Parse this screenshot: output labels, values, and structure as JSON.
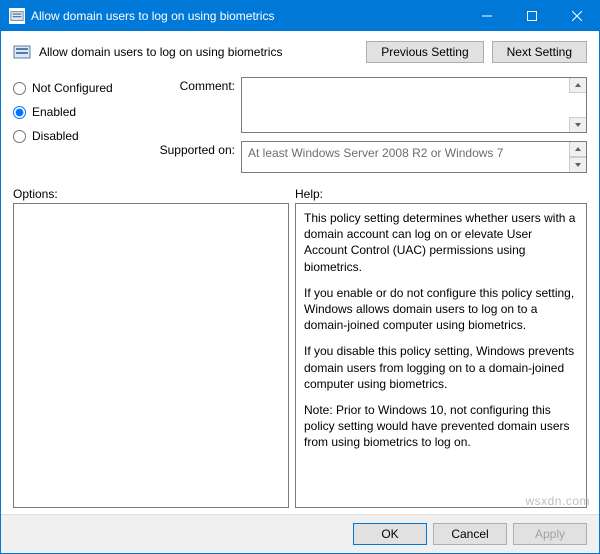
{
  "titlebar": {
    "text": "Allow domain users to log on using biometrics"
  },
  "header": {
    "title": "Allow domain users to log on using biometrics",
    "prev_label": "Previous Setting",
    "next_label": "Next Setting"
  },
  "radios": {
    "not_configured": "Not Configured",
    "enabled": "Enabled",
    "disabled": "Disabled",
    "selected": "enabled"
  },
  "fields": {
    "comment_label": "Comment:",
    "comment_value": "",
    "supported_label": "Supported on:",
    "supported_value": "At least Windows Server 2008 R2 or Windows 7"
  },
  "panes": {
    "options_label": "Options:",
    "help_label": "Help:",
    "help_paragraphs": [
      "This policy setting determines whether users with a domain account can log on or elevate User Account Control (UAC) permissions using biometrics.",
      "If you enable or do not configure this policy setting, Windows allows domain users to log on to a domain-joined computer using biometrics.",
      "If you disable this policy setting, Windows prevents domain users from logging on to a domain-joined computer using biometrics.",
      "Note: Prior to Windows 10, not configuring this policy setting would have prevented domain users from using biometrics to log on."
    ]
  },
  "buttons": {
    "ok": "OK",
    "cancel": "Cancel",
    "apply": "Apply"
  },
  "watermark": "wsxdn.com"
}
